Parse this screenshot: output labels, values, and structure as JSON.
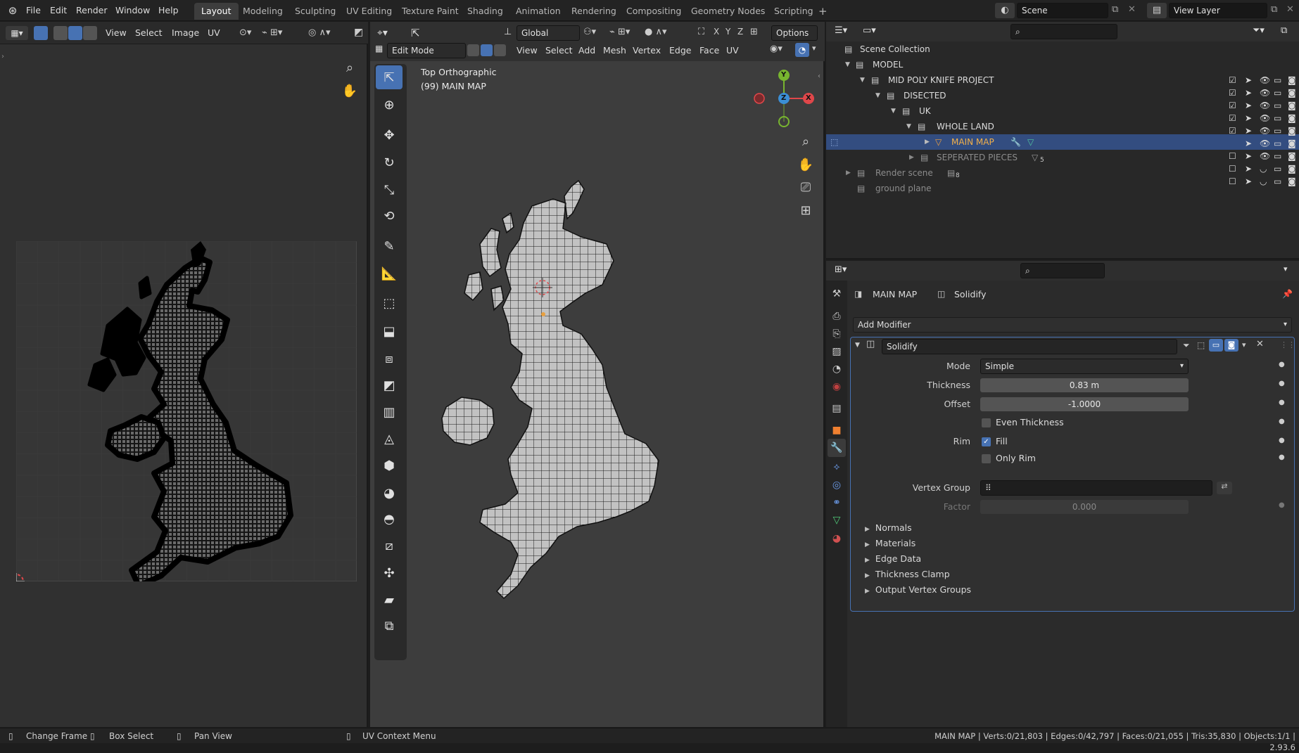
{
  "topbar": {
    "menus": [
      "File",
      "Edit",
      "Render",
      "Window",
      "Help"
    ],
    "workspaces": [
      "Layout",
      "Modeling",
      "Sculpting",
      "UV Editing",
      "Texture Paint",
      "Shading",
      "Animation",
      "Rendering",
      "Compositing",
      "Geometry Nodes",
      "Scripting"
    ],
    "active_workspace": "Layout",
    "add_tab": "+",
    "scene": "Scene",
    "view_layer": "View Layer"
  },
  "uv_editor": {
    "menus": [
      "View",
      "Select",
      "Image",
      "UV"
    ]
  },
  "viewport": {
    "header_menus": [
      "View",
      "Select",
      "Add",
      "Mesh",
      "Vertex",
      "Edge",
      "Face",
      "UV"
    ],
    "mode": "Edit Mode",
    "orientation": "Global",
    "options": "Options",
    "axes_x": "X",
    "axes_y": "Y",
    "axes_z": "Z",
    "view_name": "Top Orthographic",
    "object_label": "(99) MAIN MAP",
    "gizmo_y": "Y",
    "gizmo_z": "Z",
    "gizmo_x": "X"
  },
  "outliner": {
    "rows": [
      {
        "label": "Scene Collection"
      },
      {
        "label": "MODEL"
      },
      {
        "label": "MID POLY KNIFE PROJECT"
      },
      {
        "label": "DISECTED"
      },
      {
        "label": "UK"
      },
      {
        "label": "WHOLE LAND"
      },
      {
        "label": "MAIN MAP"
      },
      {
        "label": "SEPERATED PIECES"
      },
      {
        "label": "Render scene"
      },
      {
        "label": "ground plane"
      }
    ],
    "separated_count": "5",
    "render_count": "8"
  },
  "properties": {
    "object": "MAIN MAP",
    "modifier_crumb": "Solidify",
    "add_modifier": "Add Modifier",
    "modifier_name": "Solidify",
    "mode_label": "Mode",
    "mode_value": "Simple",
    "thickness_label": "Thickness",
    "thickness_value": "0.83 m",
    "offset_label": "Offset",
    "offset_value": "-1.0000",
    "even_thickness": "Even Thickness",
    "rim_label": "Rim",
    "fill": "Fill",
    "only_rim": "Only Rim",
    "vertex_group_label": "Vertex Group",
    "factor_label": "Factor",
    "factor_value": "0.000",
    "sections": [
      "Normals",
      "Materials",
      "Edge Data",
      "Thickness Clamp",
      "Output Vertex Groups"
    ]
  },
  "statusbar": {
    "change_frame": "Change Frame",
    "box_select": "Box Select",
    "pan_view": "Pan View",
    "uv_menu": "UV Context Menu",
    "stats": "MAIN MAP | Verts:0/21,803 | Edges:0/42,797 | Faces:0/21,055 | Tris:35,830 | Objects:1/1 | 2.93.6"
  },
  "colors": {
    "accent": "#4772b3",
    "selected_row": "#334d80",
    "background": "#1d1d1d",
    "axis_x": "#e0474a",
    "axis_y": "#78b52f",
    "axis_z": "#3b8fd6"
  }
}
